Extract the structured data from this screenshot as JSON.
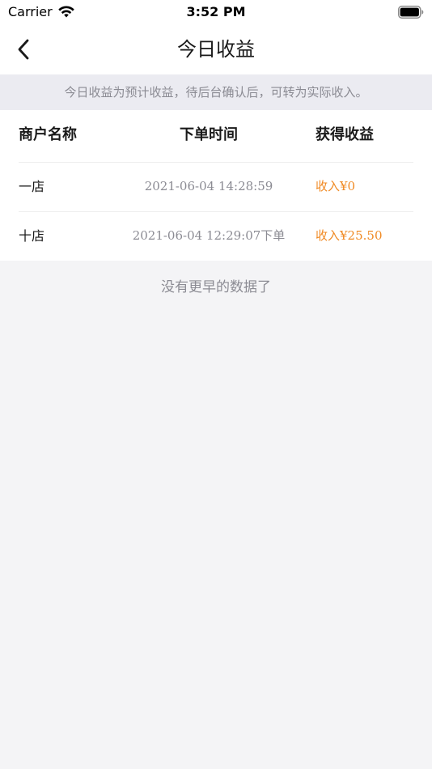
{
  "status_bar": {
    "carrier": "Carrier",
    "time": "3:52 PM",
    "wifi_icon": "wifi-icon",
    "battery_icon": "battery-icon"
  },
  "nav": {
    "title": "今日收益",
    "back_icon": "chevron-left-icon"
  },
  "notice": "今日收益为预计收益，待后台确认后，可转为实际收入。",
  "table": {
    "headers": {
      "merchant": "商户名称",
      "time": "下单时间",
      "income": "获得收益"
    },
    "rows": [
      {
        "merchant": "一店",
        "time": "2021-06-04 14:28:59",
        "income": "收入¥0"
      },
      {
        "merchant": "十店",
        "time": "2021-06-04 12:29:07下单",
        "income": "收入¥25.50"
      }
    ]
  },
  "end_text": "没有更早的数据了",
  "colors": {
    "accent_orange": "#f08a24",
    "muted_text": "#8b8b93",
    "page_bg": "#f4f4f6",
    "notice_bg": "#ebebf1"
  }
}
